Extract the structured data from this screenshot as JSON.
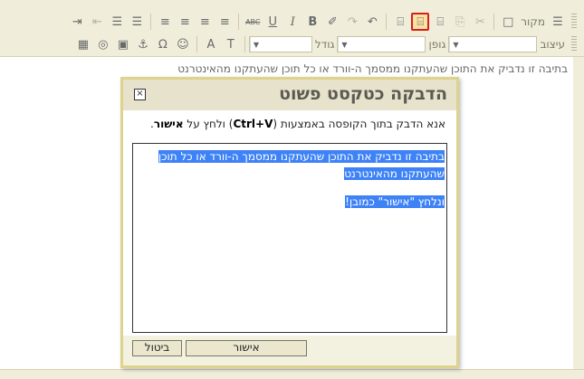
{
  "toolbar": {
    "row1": {
      "source_label": "מקור",
      "buttons": [
        {
          "icon": "source-icon",
          "label": "☰"
        },
        {
          "icon": "preview-icon",
          "label": "□"
        },
        {
          "icon": "cut-icon",
          "label": "✂"
        },
        {
          "icon": "copy-icon",
          "label": "⎘"
        },
        {
          "icon": "paste-icon",
          "label": "⌸"
        },
        {
          "icon": "paste-text-icon",
          "label": "⌸"
        },
        {
          "icon": "paste-word-icon",
          "label": "⌸"
        },
        {
          "icon": "undo-icon",
          "label": "↶"
        },
        {
          "icon": "redo-icon",
          "label": "↷"
        },
        {
          "icon": "eraser-icon",
          "label": "✐"
        },
        {
          "icon": "bold-icon",
          "label": "B"
        },
        {
          "icon": "italic-icon",
          "label": "I"
        },
        {
          "icon": "underline-icon",
          "label": "U"
        },
        {
          "icon": "strike-icon",
          "label": "ABC"
        },
        {
          "icon": "align-left-icon",
          "label": "≡"
        },
        {
          "icon": "align-center-icon",
          "label": "≡"
        },
        {
          "icon": "align-right-icon",
          "label": "≡"
        },
        {
          "icon": "align-justify-icon",
          "label": "≡"
        },
        {
          "icon": "numbered-list-icon",
          "label": "☰"
        },
        {
          "icon": "bullet-list-icon",
          "label": "☰"
        },
        {
          "icon": "outdent-icon",
          "label": "⇤"
        },
        {
          "icon": "indent-icon",
          "label": "⇥"
        }
      ]
    },
    "row2": {
      "style_label": "עיצוב",
      "font_label": "גופן",
      "size_label": "גודל",
      "buttons": [
        {
          "icon": "text-color-icon",
          "label": "T"
        },
        {
          "icon": "bg-color-icon",
          "label": "A"
        },
        {
          "icon": "smiley-icon",
          "label": "☺"
        },
        {
          "icon": "special-char-icon",
          "label": "Ω"
        },
        {
          "icon": "anchor-icon",
          "label": "⚓"
        },
        {
          "icon": "image-icon",
          "label": "▣"
        },
        {
          "icon": "flash-icon",
          "label": "◎"
        },
        {
          "icon": "table-icon",
          "label": "▦"
        }
      ]
    }
  },
  "content": {
    "text": "בתיבה זו נדביק את התוכן שהעתקנו ממסמך ה-וורד או כל תוכן שהעתקנו מהאינטרנט"
  },
  "dialog": {
    "title": "הדבקה כטקסט פשוט",
    "close": "☒",
    "instruction_pre": "אנא הדבק בתוך הקופסה באמצעות (",
    "instruction_key": "Ctrl+V",
    "instruction_mid": ") ולחץ על ",
    "instruction_bold": "אישור",
    "instruction_end": ".",
    "paste_line1": "בתיבה זו נדביק את התוכן שהעתקנו ממסמך ה-וורד או כל תוכן",
    "paste_line2": "שהעתקנו מהאינטרנט",
    "paste_line3": "ונלחץ \"אישור\" כמובן!",
    "ok_label": "אישור",
    "cancel_label": "ביטול"
  }
}
